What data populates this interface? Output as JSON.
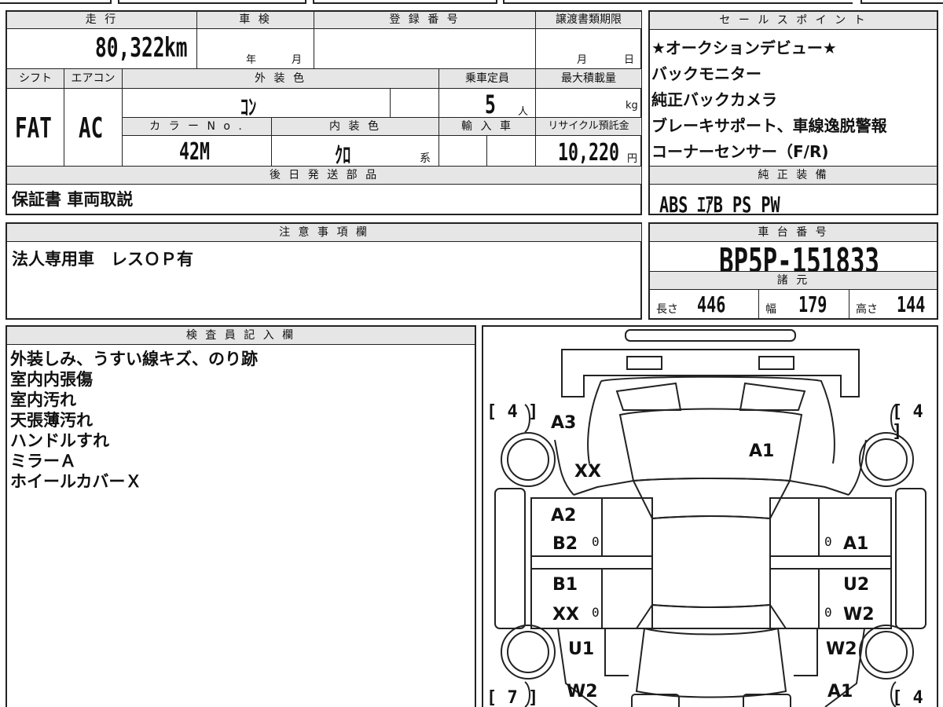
{
  "header": {
    "mileage_label": "走 行",
    "inspection_label": "車 検",
    "registration_label": "登 録 番 号",
    "transfer_deadline_label": "譲渡書類期限"
  },
  "mileage": {
    "value": "80,322",
    "unit": "km"
  },
  "inspection": {
    "year_unit": "年",
    "month_unit": "月"
  },
  "transfer_deadline": {
    "month_unit": "月",
    "day_unit": "日"
  },
  "row2_labels": {
    "shift": "シフト",
    "aircon": "エアコン",
    "exterior_color": "外 装 色",
    "capacity": "乗車定員",
    "max_load": "最大積載量"
  },
  "shift": "FAT",
  "aircon": "AC",
  "exterior_color": "ｺﾝ",
  "capacity": {
    "value": "5",
    "unit": "人"
  },
  "max_load": {
    "unit": "kg"
  },
  "row3_labels": {
    "color_no": "カ ラ ー N o .",
    "interior_color": "内 装 色",
    "import": "輸 入 車",
    "recycle": "リサイクル預託金"
  },
  "color_no": "42M",
  "interior_color": {
    "value": "ｸﾛ",
    "suffix": "系"
  },
  "recycle": {
    "value": "10,220",
    "unit": "円"
  },
  "later_parts": {
    "label": "後 日 発 送 部 品",
    "value": "保証書 車両取説"
  },
  "notes": {
    "label": "注 意 事 項 欄",
    "value": "法人専用車　レスＯＰ有"
  },
  "sales_points": {
    "label": "セ ー ル ス ポ イ ン ト",
    "items": [
      "★オークションデビュー★",
      "バックモニター",
      "純正バックカメラ",
      "ブレーキサポート、車線逸脱警報",
      "コーナーセンサー（F/R)"
    ]
  },
  "equipment": {
    "label": "純 正 装 備",
    "value": "ABS ｴｱB PS PW"
  },
  "chassis": {
    "label": "車 台 番 号",
    "value": "BP5P-151833"
  },
  "specs": {
    "label": "諸 元",
    "length_label": "長さ",
    "length": "446",
    "width_label": "幅",
    "width": "179",
    "height_label": "高さ",
    "height": "144"
  },
  "inspector": {
    "label": "検 査 員 記 入 欄",
    "lines": [
      "外装しみ、うすい線キズ、のり跡",
      "室内内張傷",
      "室内汚れ",
      "天張薄汚れ",
      "ハンドルすれ",
      "ミラーＡ",
      "ホイールカバーＸ"
    ]
  },
  "diagram": {
    "tire_fl": "4",
    "tire_fr": "4",
    "tire_rl": "7",
    "tire_rr": "4",
    "labels": {
      "a3": "A3",
      "xx_front": "XX",
      "a1_hood": "A1",
      "a2": "A2",
      "b2": "B2",
      "a1_right": "A1",
      "b1": "B1",
      "xx_left": "XX",
      "u2": "U2",
      "w2_right": "W2",
      "u1": "U1",
      "w2_rear_r": "W2",
      "w2_rear_l": "W2",
      "a1_rear_r": "A1",
      "zero": "0"
    }
  }
}
